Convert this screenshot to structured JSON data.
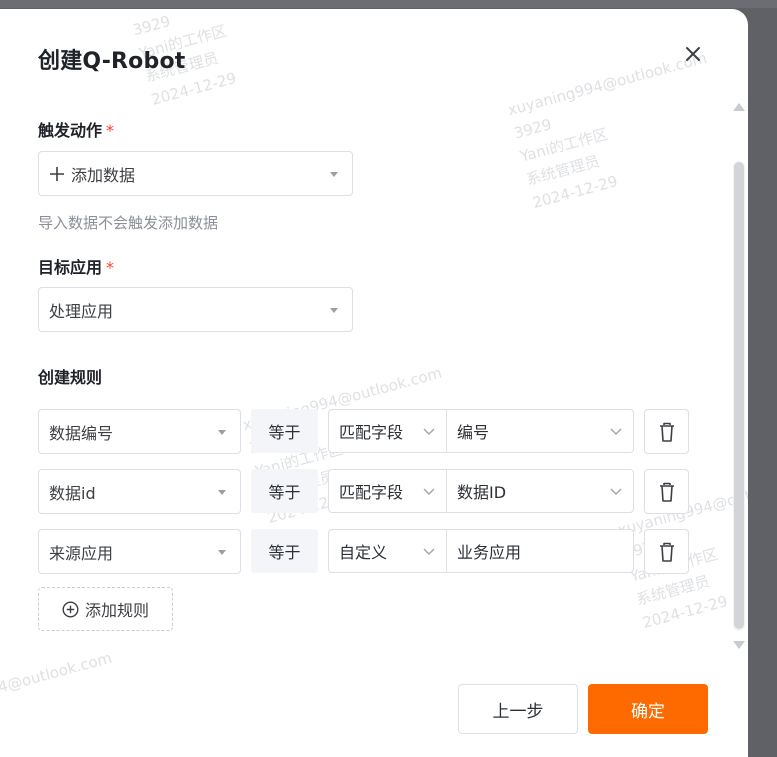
{
  "dialog": {
    "title": "创建Q-Robot",
    "close_icon": "close-icon"
  },
  "trigger": {
    "label": "触发动作",
    "required_mark": "*",
    "add_label": "添加数据",
    "hint": "导入数据不会触发添加数据"
  },
  "target": {
    "label": "目标应用",
    "required_mark": "*",
    "value": "处理应用"
  },
  "rules": {
    "label": "创建规则",
    "items": [
      {
        "field": "数据编号",
        "operator": "等于",
        "match_type": "匹配字段",
        "value": "编号"
      },
      {
        "field": "数据id",
        "operator": "等于",
        "match_type": "匹配字段",
        "value": "数据ID"
      },
      {
        "field": "来源应用",
        "operator": "等于",
        "match_type": "自定义",
        "value": "业务应用"
      }
    ],
    "add_label": "添加规则"
  },
  "footer": {
    "prev_label": "上一步",
    "confirm_label": "确定"
  },
  "watermark": {
    "email": "xuyaning994@outlook.com",
    "id": "3929",
    "workspace": "Yani的工作区",
    "role": "系统管理员",
    "date": "2024-12-29"
  },
  "colors": {
    "primary": "#ff6a00",
    "required": "#f5422a"
  }
}
